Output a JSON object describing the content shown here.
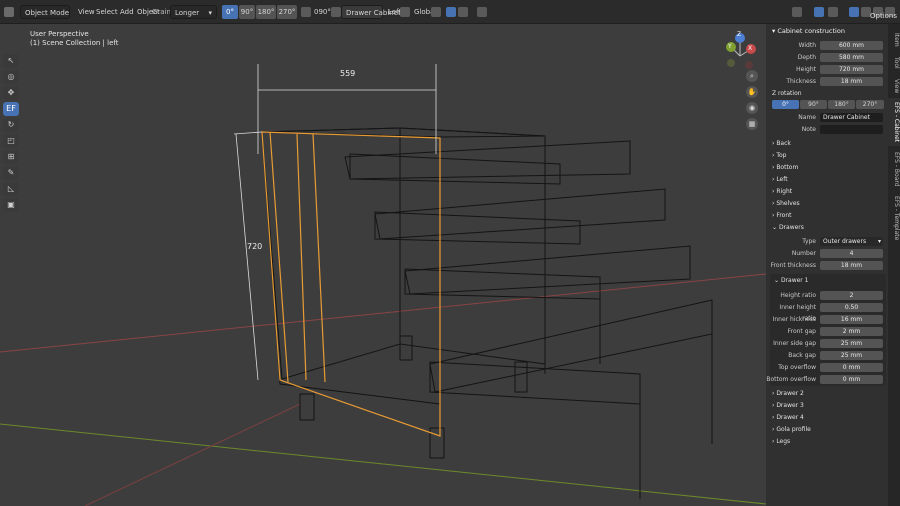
{
  "topbar": {
    "mode": "Object Mode",
    "menus": [
      "View",
      "Select",
      "Add",
      "Object"
    ],
    "grain_label": "Grain:",
    "grain_value": "Longer",
    "rotations": [
      "0°",
      "90°",
      "180°",
      "270°"
    ],
    "angle": "090°",
    "object_name": "Drawer Cabinet",
    "side": "Left",
    "transform": "Global",
    "options": "Options"
  },
  "viewport": {
    "perspective": "User Perspective",
    "collection": "(1) Scene Collection | left",
    "dim_width": "559",
    "dim_height": "720",
    "gizmo": {
      "x": "X",
      "y": "Y",
      "z": "Z"
    },
    "colors": {
      "x_axis": "#b34a4a",
      "y_axis": "#7fa02f",
      "selected": "#e89b35",
      "wire": "#141414"
    }
  },
  "tools": [
    "cursor",
    "select",
    "move",
    "ef",
    "rotate",
    "scale",
    "transform",
    "annotate",
    "measure",
    "add-cube"
  ],
  "panel": {
    "header": "Cabinet construction",
    "width_label": "Width",
    "width_value": "600 mm",
    "depth_label": "Depth",
    "depth_value": "580 mm",
    "height_label": "Height",
    "height_value": "720 mm",
    "thickness_label": "Thickness",
    "thickness_value": "18 mm",
    "zrot_label": "Z rotation",
    "zrot_options": [
      "0°",
      "90°",
      "180°",
      "270°"
    ],
    "name_label": "Name",
    "name_value": "Drawer Cabinet",
    "note_label": "Note",
    "note_value": "",
    "sections": [
      "Back",
      "Top",
      "Bottom",
      "Left",
      "Right",
      "Shelves",
      "Front"
    ],
    "drawers_label": "Drawers",
    "type_label": "Type",
    "type_value": "Outer drawers",
    "number_label": "Number",
    "number_value": "4",
    "front_thickness_label": "Front thickness",
    "front_thickness_value": "18 mm",
    "drawer1_label": "Drawer 1",
    "drawer1_fields": [
      {
        "label": "Height ratio",
        "value": "2"
      },
      {
        "label": "Inner height ratio",
        "value": "0.50"
      },
      {
        "label": "Inner hickness",
        "value": "16 mm"
      },
      {
        "label": "Front gap",
        "value": "2 mm"
      },
      {
        "label": "Inner side gap",
        "value": "25 mm"
      },
      {
        "label": "Back gap",
        "value": "25 mm"
      },
      {
        "label": "Top overflow",
        "value": "0 mm"
      },
      {
        "label": "Bottom overflow",
        "value": "0 mm"
      }
    ],
    "more_sections": [
      "Drawer 2",
      "Drawer 3",
      "Drawer 4",
      "Gola profile",
      "Legs"
    ]
  },
  "side_tabs": [
    "Item",
    "Tool",
    "View",
    "EFS - Cabinet",
    "EFS - Board",
    "EFS - Template"
  ]
}
